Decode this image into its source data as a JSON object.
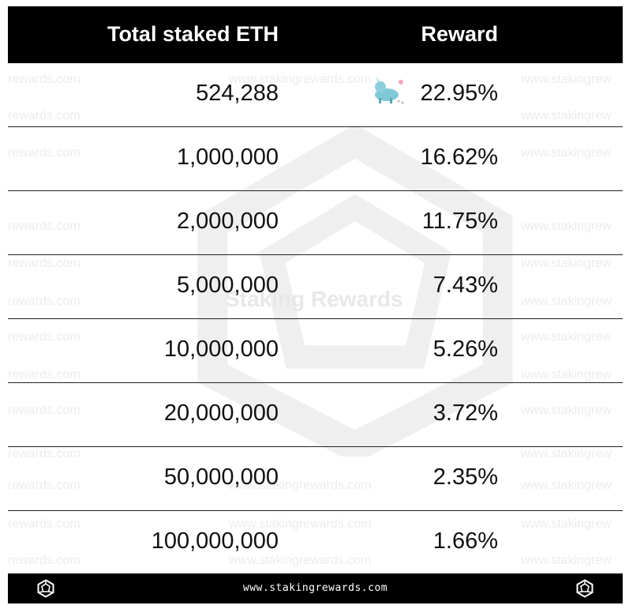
{
  "table": {
    "header": {
      "col1": "Total staked ETH",
      "col2": "Reward"
    },
    "rows": [
      {
        "eth": "524,288",
        "reward": "22.95%"
      },
      {
        "eth": "1,000,000",
        "reward": "16.62%"
      },
      {
        "eth": "2,000,000",
        "reward": "11.75%"
      },
      {
        "eth": "5,000,000",
        "reward": "7.43%"
      },
      {
        "eth": "10,000,000",
        "reward": "5.26%"
      },
      {
        "eth": "20,000,000",
        "reward": "3.72%"
      },
      {
        "eth": "50,000,000",
        "reward": "2.35%"
      },
      {
        "eth": "100,000,000",
        "reward": "1.66%"
      }
    ]
  },
  "watermark": {
    "center": "Staking Rewards",
    "left": "rewards.com",
    "right": "www.stakingrew",
    "mid": "www.stakingrewards.com"
  },
  "footer": {
    "url": "www.stakingrewards.com"
  },
  "colors": {
    "header_bg": "#000000",
    "row_border": "#222222",
    "text": "#111111"
  },
  "icons": [
    "staking-rewards-logo-icon",
    "rhino-mascot-icon"
  ]
}
